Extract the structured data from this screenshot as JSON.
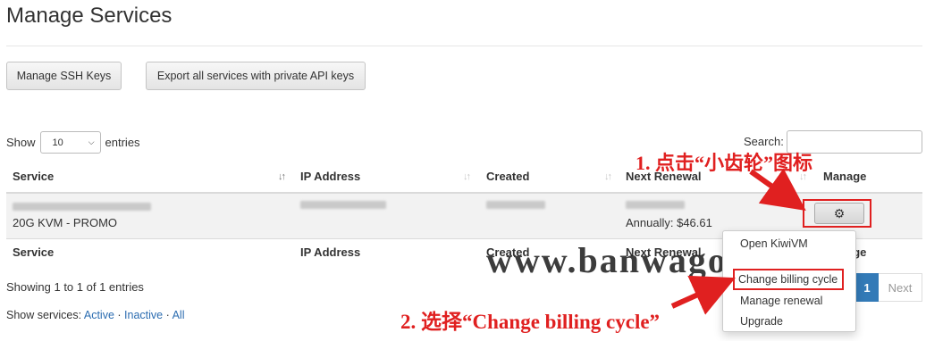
{
  "page": {
    "title": "Manage Services"
  },
  "buttons": {
    "manage_ssh_keys": "Manage SSH Keys",
    "export_services": "Export all services with private API keys"
  },
  "table_controls": {
    "show_label": "Show",
    "entries_value": "10",
    "entries_label": "entries",
    "search_label": "Search:",
    "search_value": ""
  },
  "table": {
    "columns": [
      "Service",
      "IP Address",
      "Created",
      "Next Renewal",
      "Manage"
    ],
    "rows": [
      {
        "service_hostname": "blurred hostname",
        "service_plan": "20G KVM - PROMO",
        "ip_address": "blurred IP",
        "created": "blurred date",
        "next_renewal_date": "blurred date",
        "renewal_amount": "Annually: $46.61"
      }
    ],
    "info": "Showing 1 to 1 of 1 entries"
  },
  "manage_menu": {
    "gear_icon": "gear-icon",
    "items": [
      "Open KiwiVM",
      "Change billing cycle",
      "Manage renewal",
      "Upgrade"
    ]
  },
  "pagination": {
    "current": "1",
    "next": "Next"
  },
  "show_services": {
    "label": "Show services:",
    "filters": [
      "Active",
      "Inactive",
      "All"
    ],
    "separator": "·"
  },
  "annotations": {
    "step1": "1. 点击“小齿轮”图标",
    "step2": "2. 选择“Change billing cycle”",
    "watermark": "www.banwago.net",
    "highlight_color": "#e02020"
  },
  "colors": {
    "link": "#2b6cb0",
    "pagination_active": "#337ab7"
  }
}
